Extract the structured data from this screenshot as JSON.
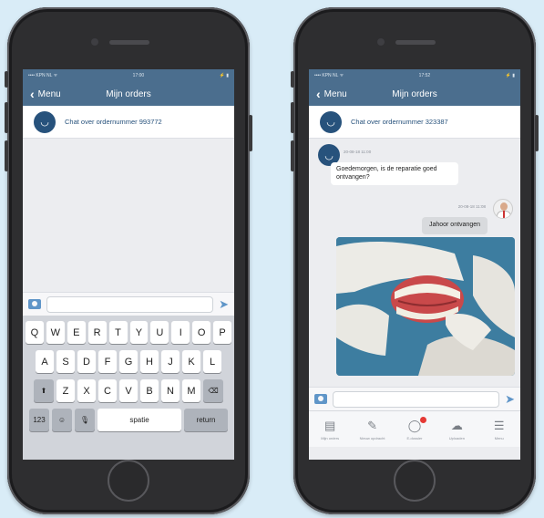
{
  "colors": {
    "header_bg": "#4b6e8e",
    "accent": "#5f95c8",
    "logo_bg": "#27527c",
    "background": "#d9ecf7"
  },
  "left_phone": {
    "status": {
      "carrier": "•••• KPN NL ᯤ",
      "time": "17:00",
      "battery": "⚡ ▮"
    },
    "nav": {
      "back_label": "Menu",
      "title": "Mijn orders"
    },
    "chat": {
      "title": "Chat over ordernummer 993772"
    },
    "input": {
      "placeholder": ""
    },
    "keyboard": {
      "row1": [
        "Q",
        "W",
        "E",
        "R",
        "T",
        "Y",
        "U",
        "I",
        "O",
        "P"
      ],
      "row2": [
        "A",
        "S",
        "D",
        "F",
        "G",
        "H",
        "J",
        "K",
        "L"
      ],
      "row3": [
        "Z",
        "X",
        "C",
        "V",
        "B",
        "N",
        "M"
      ],
      "shift": "⬆",
      "backspace": "⌫",
      "numbers": "123",
      "emoji": "☺",
      "mic": "🎙",
      "space": "spatie",
      "return": "return"
    }
  },
  "right_phone": {
    "status": {
      "carrier": "•••• KPN NL ᯤ",
      "time": "17:52",
      "battery": "⚡ ▮"
    },
    "nav": {
      "back_label": "Menu",
      "title": "Mijn orders"
    },
    "chat": {
      "title": "Chat over ordernummer 323387",
      "message_in": {
        "time": "20-08-18 11:00",
        "text": "Goedemorgen, is de reparatie goed ontvangen?"
      },
      "message_out": {
        "time": "20-08-18 11:08",
        "text": "Jahoor ontvangen"
      }
    },
    "input": {
      "placeholder": ""
    },
    "tabs": [
      {
        "label": "Mijn orders",
        "icon": "document-icon"
      },
      {
        "label": "Nieuw opdracht",
        "icon": "pen-icon"
      },
      {
        "label": "E-dossier",
        "icon": "chat-icon"
      },
      {
        "label": "Uploaden",
        "icon": "upload-icon"
      },
      {
        "label": "Menu",
        "icon": "menu-icon"
      }
    ]
  }
}
